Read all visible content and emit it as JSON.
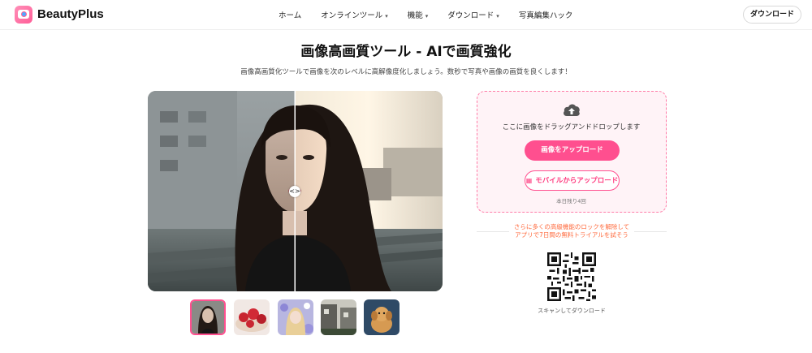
{
  "header": {
    "brand": "BeautyPlus",
    "nav": [
      {
        "label": "ホーム",
        "dropdown": false
      },
      {
        "label": "オンラインツール",
        "dropdown": true
      },
      {
        "label": "機能",
        "dropdown": true
      },
      {
        "label": "ダウンロード",
        "dropdown": true
      },
      {
        "label": "写真編集ハック",
        "dropdown": false
      }
    ],
    "download_label": "ダウンロード"
  },
  "main": {
    "title": "画像高画質ツール - AIで画質強化",
    "subtitle": "画像高画質化ツールで画像を次のレベルに高解像度化しましょう。数秒で写真や画像の画質を良くします！"
  },
  "compare": {
    "handle_icon": "<>"
  },
  "thumbnails": [
    {
      "name": "portrait-thumbnail",
      "active": true
    },
    {
      "name": "cake-thumbnail",
      "active": false
    },
    {
      "name": "girl-flowers-thumbnail",
      "active": false
    },
    {
      "name": "street-thumbnail",
      "active": false
    },
    {
      "name": "puppy-thumbnail",
      "active": false
    }
  ],
  "upload": {
    "drop_text": "ここに画像をドラッグアンドドロップします",
    "upload_button": "画像をアップロード",
    "mobile_button": "モバイルからアップロード",
    "remaining": "本日残り4回"
  },
  "promo": {
    "line1": "さらに多くの高級機能のロックを解除して",
    "line2": "アプリで7日間の無料トライアルを試そう"
  },
  "qr": {
    "label": "スキャンしてダウンロード"
  },
  "colors": {
    "accent": "#ff4f8f",
    "upload_bg": "#fff3f7",
    "promo_text": "#ff6a3d"
  }
}
